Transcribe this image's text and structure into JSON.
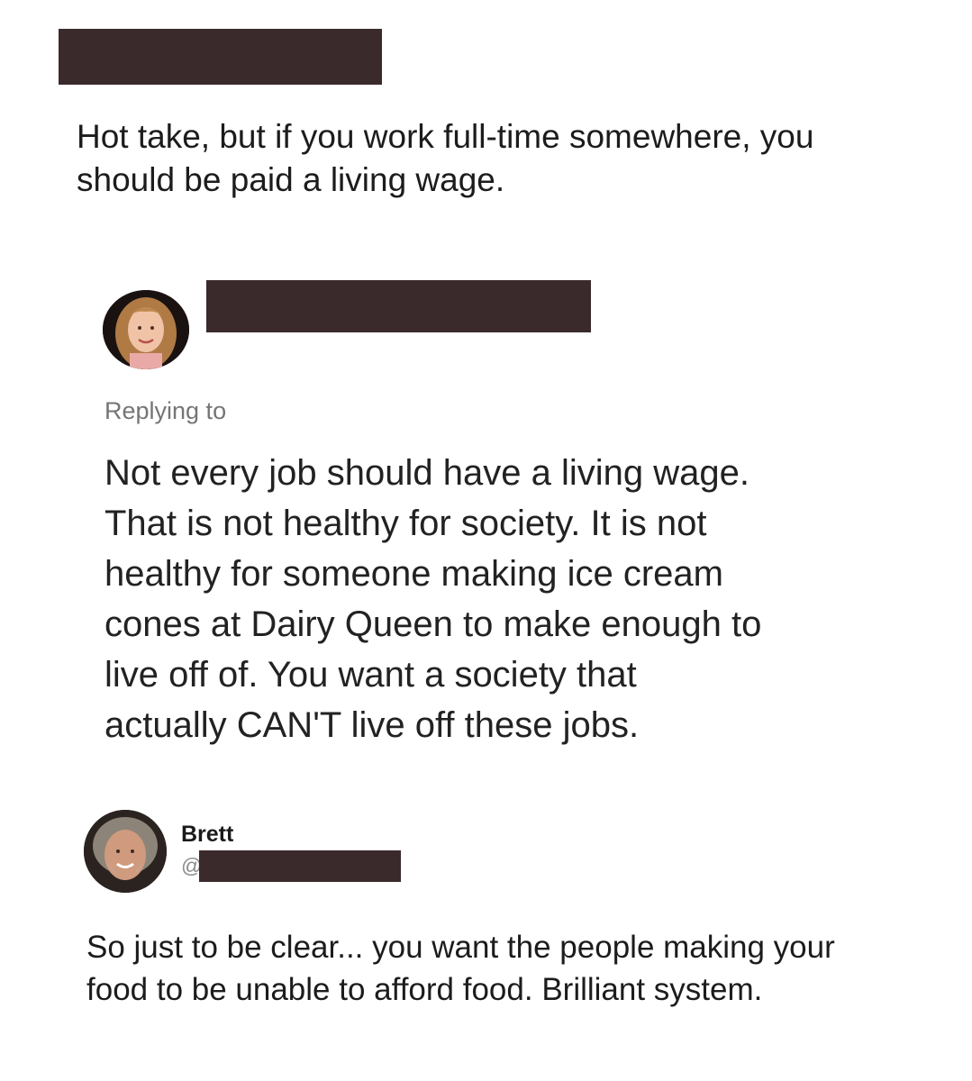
{
  "post1": {
    "text": "Hot take, but if you work full-time somewhere, you\nshould be paid a living wage."
  },
  "post2": {
    "replying_label": "Replying to",
    "text": "Not every job should have a living wage.\nThat is not healthy for society. It is not\nhealthy for someone making ice cream\ncones at Dairy Queen to make enough to\nlive off of.  You want a society that\nactually CAN'T live off these jobs."
  },
  "post3": {
    "author_name": "Brett",
    "handle_prefix": "@",
    "text": "So just to be clear... you want the people making your\nfood to be unable to afford food. Brilliant system."
  },
  "colors": {
    "redaction": "#3b2a2c",
    "secondary_text": "#757575"
  }
}
